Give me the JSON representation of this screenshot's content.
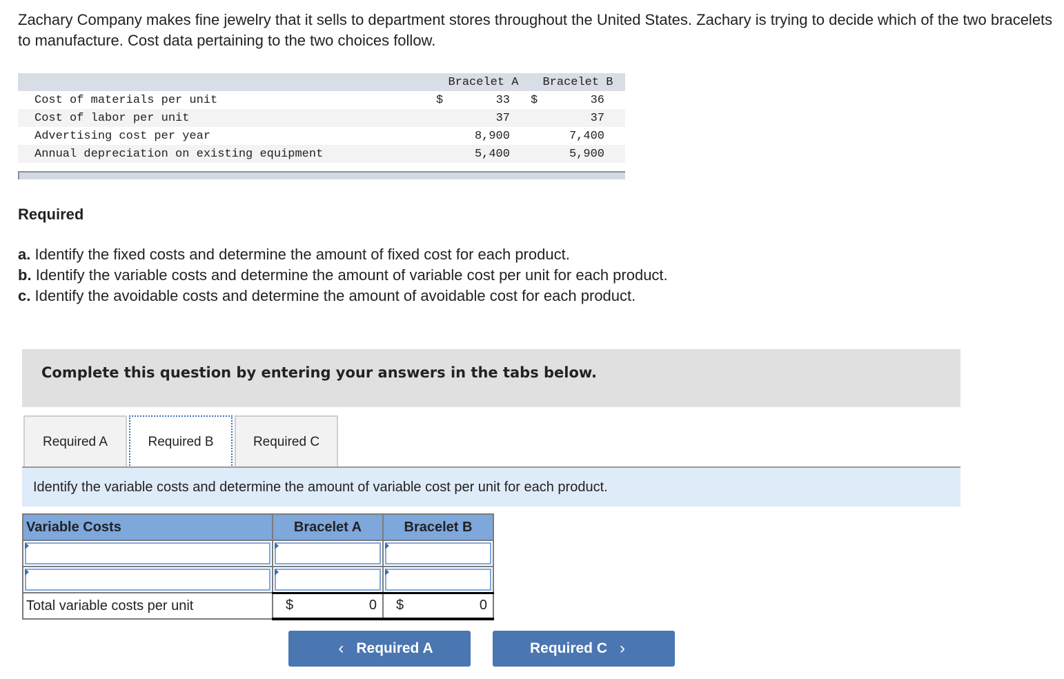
{
  "intro": "Zachary Company makes fine jewelry that it sells to department stores throughout the United States. Zachary is trying to decide which of the two bracelets to manufacture. Cost data pertaining to the two choices follow.",
  "cost_table": {
    "headers": [
      "Bracelet A",
      "Bracelet B"
    ],
    "rows": [
      {
        "label": "Cost of materials per unit",
        "a_cur": "$",
        "a": "33",
        "b_cur": "$",
        "b": "36"
      },
      {
        "label": "Cost of labor per unit",
        "a_cur": "",
        "a": "37",
        "b_cur": "",
        "b": "37"
      },
      {
        "label": "Advertising cost per year",
        "a_cur": "",
        "a": "8,900",
        "b_cur": "",
        "b": "7,400"
      },
      {
        "label": "Annual depreciation on existing equipment",
        "a_cur": "",
        "a": "5,400",
        "b_cur": "",
        "b": "5,900"
      }
    ]
  },
  "required": {
    "title": "Required",
    "items": [
      {
        "letter": "a.",
        "text": "Identify the fixed costs and determine the amount of fixed cost for each product."
      },
      {
        "letter": "b.",
        "text": "Identify the variable costs and determine the amount of variable cost per unit for each product."
      },
      {
        "letter": "c.",
        "text": "Identify the avoidable costs and determine the amount of avoidable cost for each product."
      }
    ]
  },
  "instructions": "Complete this question by entering your answers in the tabs below.",
  "tabs": [
    {
      "label": "Required A",
      "active": false
    },
    {
      "label": "Required B",
      "active": true
    },
    {
      "label": "Required C",
      "active": false
    }
  ],
  "prompt": "Identify the variable costs and determine the amount of variable cost per unit for each product.",
  "answer_table": {
    "headers": [
      "Variable Costs",
      "Bracelet A",
      "Bracelet B"
    ],
    "input_rows": [
      {
        "label": "",
        "a": "",
        "b": ""
      },
      {
        "label": "",
        "a": "",
        "b": ""
      }
    ],
    "total": {
      "label": "Total variable costs per unit",
      "a_cur": "$",
      "a": "0",
      "b_cur": "$",
      "b": "0"
    }
  },
  "nav": {
    "prev_label": "Required A",
    "next_label": "Required C",
    "prev_icon": "‹",
    "next_icon": "›"
  }
}
